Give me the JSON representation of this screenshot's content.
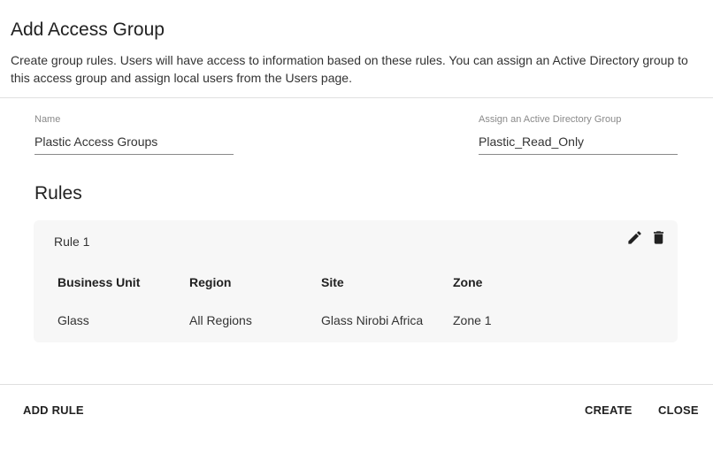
{
  "dialog": {
    "title": "Add Access Group",
    "description": "Create group rules. Users will have access to information based on these rules. You can assign an Active Directory group to this access group and assign local users from the Users page."
  },
  "form": {
    "name_label": "Name",
    "name_value": "Plastic Access Groups",
    "ad_group_label": "Assign an Active Directory Group",
    "ad_group_value": "Plastic_Read_Only"
  },
  "rules": {
    "heading": "Rules",
    "items": [
      {
        "title": "Rule 1",
        "edit_icon": "pencil-icon",
        "delete_icon": "trash-icon",
        "columns": [
          "Business Unit",
          "Region",
          "Site",
          "Zone"
        ],
        "values": [
          "Glass",
          "All Regions",
          "Glass Nirobi Africa",
          "Zone 1"
        ]
      }
    ]
  },
  "actions": {
    "add_rule": "ADD RULE",
    "create": "CREATE",
    "close": "CLOSE"
  }
}
